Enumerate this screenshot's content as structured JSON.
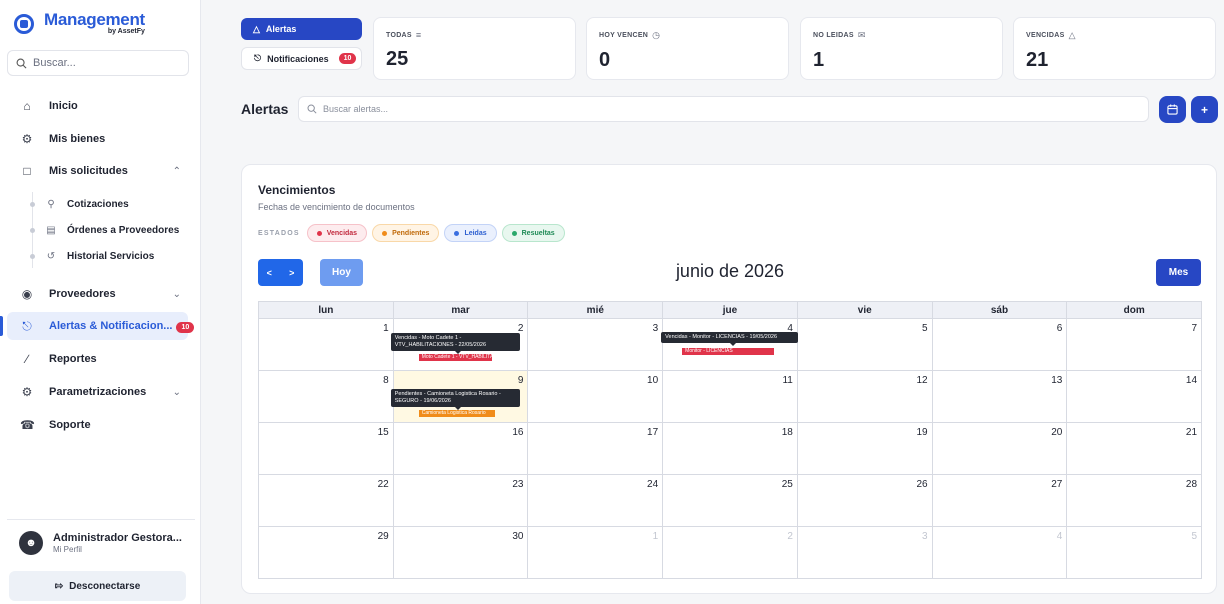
{
  "brand": {
    "title": "Management",
    "subtitle": "by AssetFy"
  },
  "sidebar": {
    "search_placeholder": "Buscar...",
    "items": [
      {
        "label": "Inicio",
        "icon": "home-icon"
      },
      {
        "label": "Mis bienes",
        "icon": "assets-icon"
      },
      {
        "label": "Mis solicitudes",
        "icon": "requests-icon",
        "expanded": true
      },
      {
        "label": "Cotizaciones",
        "icon": "quotes-icon"
      },
      {
        "label": "Órdenes a Proveedores",
        "icon": "orders-icon"
      },
      {
        "label": "Historial Servicios",
        "icon": "history-icon"
      },
      {
        "label": "Proveedores",
        "icon": "providers-icon"
      },
      {
        "label": "Alertas & Notificacion...",
        "icon": "bell-icon",
        "badge": "10",
        "active": true
      },
      {
        "label": "Reportes",
        "icon": "reports-icon"
      },
      {
        "label": "Parametrizaciones",
        "icon": "settings-icon"
      },
      {
        "label": "Soporte",
        "icon": "support-icon"
      }
    ],
    "user": {
      "name": "Administrador Gestora...",
      "role": "Mi Perfil"
    },
    "logout": "Desconectarse"
  },
  "toggles": {
    "alertas": "Alertas",
    "notificaciones": "Notificaciones",
    "notif_badge": "10"
  },
  "stats": [
    {
      "label": "TODAS",
      "icon": "list-icon",
      "value": "25"
    },
    {
      "label": "HOY VENCEN",
      "icon": "alarm-icon",
      "value": "0"
    },
    {
      "label": "NO LEIDAS",
      "icon": "mail-icon",
      "value": "1"
    },
    {
      "label": "VENCIDAS",
      "icon": "warning-icon",
      "value": "21"
    }
  ],
  "alerts": {
    "title": "Alertas",
    "search_placeholder": "Buscar alertas..."
  },
  "calendar": {
    "title": "Vencimientos",
    "subtitle": "Fechas de vencimiento de documentos",
    "estados_label": "ESTADOS",
    "legend": [
      {
        "label": "Vencidas",
        "color": "#e0344a"
      },
      {
        "label": "Pendientes",
        "color": "#f08c1a"
      },
      {
        "label": "Leidas",
        "color": "#3b6fe0"
      },
      {
        "label": "Resueltas",
        "color": "#2aa86a"
      }
    ],
    "prev": "<",
    "next": ">",
    "today_btn": "Hoy",
    "month": "junio de 2026",
    "view_btn": "Mes",
    "weekdays": [
      "lun",
      "mar",
      "mié",
      "jue",
      "vie",
      "sáb",
      "dom"
    ],
    "weeks": [
      [
        "1",
        "2",
        "3",
        "4",
        "5",
        "6",
        "7"
      ],
      [
        "8",
        "9",
        "10",
        "11",
        "12",
        "13",
        "14"
      ],
      [
        "15",
        "16",
        "17",
        "18",
        "19",
        "20",
        "21"
      ],
      [
        "22",
        "23",
        "24",
        "25",
        "26",
        "27",
        "28"
      ],
      [
        "29",
        "30",
        "1",
        "2",
        "3",
        "4",
        "5"
      ]
    ],
    "events": {
      "tip_1": "Vencidas - Moto Cadete 1 - VTV_HABILITACIONES - 22/05/2026",
      "evt_1": "Moto Cadete 1 - VTV_HABILITA",
      "tip_2": "Vencidas - Monitor - LICENCIAS - 19/05/2026",
      "evt_2": "Monitor - LICENCIAS",
      "tip_3": "Pendientes - Camioneta Logistica Rosario - SEGURO - 19/06/2026",
      "evt_3": "Camioneta Logistica Rosario"
    }
  }
}
